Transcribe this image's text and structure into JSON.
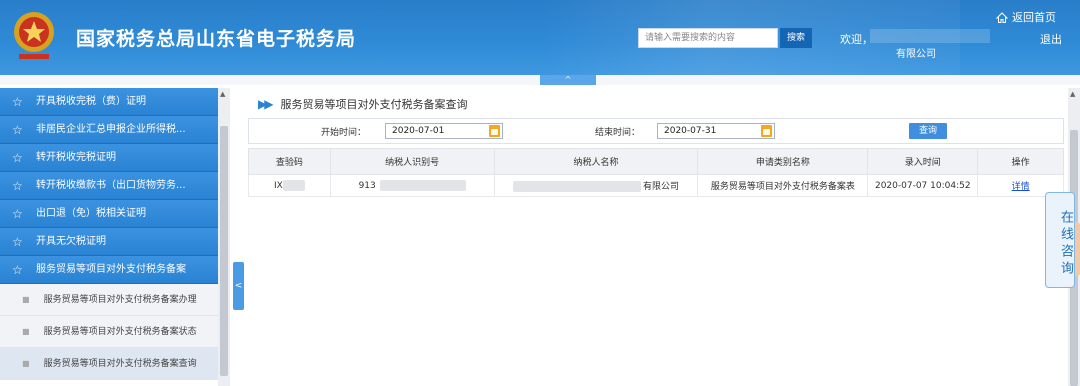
{
  "header": {
    "site_title": "国家税务总局山东省电子税务局",
    "search_placeholder": "请输入需要搜索的内容",
    "search_button": "搜索",
    "welcome": "欢迎，",
    "company": "有限公司",
    "home_link": "返回首页",
    "logout": "退出",
    "collapse_arrow": "^",
    "colors": {
      "brand": "#2f8ad6",
      "search_button": "#1565b5"
    }
  },
  "sidebar": {
    "items": [
      {
        "label": "开具税收完税（费）证明",
        "icon": "star-icon"
      },
      {
        "label": "非居民企业汇总申报企业所得税...",
        "icon": "star-icon"
      },
      {
        "label": "转开税收完税证明",
        "icon": "star-icon"
      },
      {
        "label": "转开税收缴款书（出口货物劳务...",
        "icon": "star-icon"
      },
      {
        "label": "出口退（免）税相关证明",
        "icon": "star-icon"
      },
      {
        "label": "开具无欠税证明",
        "icon": "star-icon"
      },
      {
        "label": "服务贸易等项目对外支付税务备案",
        "icon": "star-icon"
      }
    ],
    "subitems": [
      {
        "label": "服务贸易等项目对外支付税务备案办理"
      },
      {
        "label": "服务贸易等项目对外支付税务备案状态"
      },
      {
        "label": "服务贸易等项目对外支付税务备案查询"
      }
    ],
    "toggle": "<"
  },
  "main": {
    "page_title": "服务贸易等项目对外支付税务备案查询",
    "filters": {
      "start_label": "开始时间：",
      "start_value": "2020-07-01",
      "end_label": "结束时间：",
      "end_value": "2020-07-31",
      "query_button": "查询"
    },
    "table": {
      "headers": [
        "查验码",
        "纳税人识别号",
        "纳税人名称",
        "申请类别名称",
        "录入时间",
        "操作"
      ],
      "rows": [
        {
          "code": "IX",
          "taxpayer_id": "913",
          "taxpayer_name": "有限公司",
          "category": "服务贸易等项目对外支付税务备案表",
          "time": "2020-07-07 10:04:52",
          "action": "详情"
        }
      ]
    }
  },
  "consult": {
    "label": "在线咨询"
  }
}
